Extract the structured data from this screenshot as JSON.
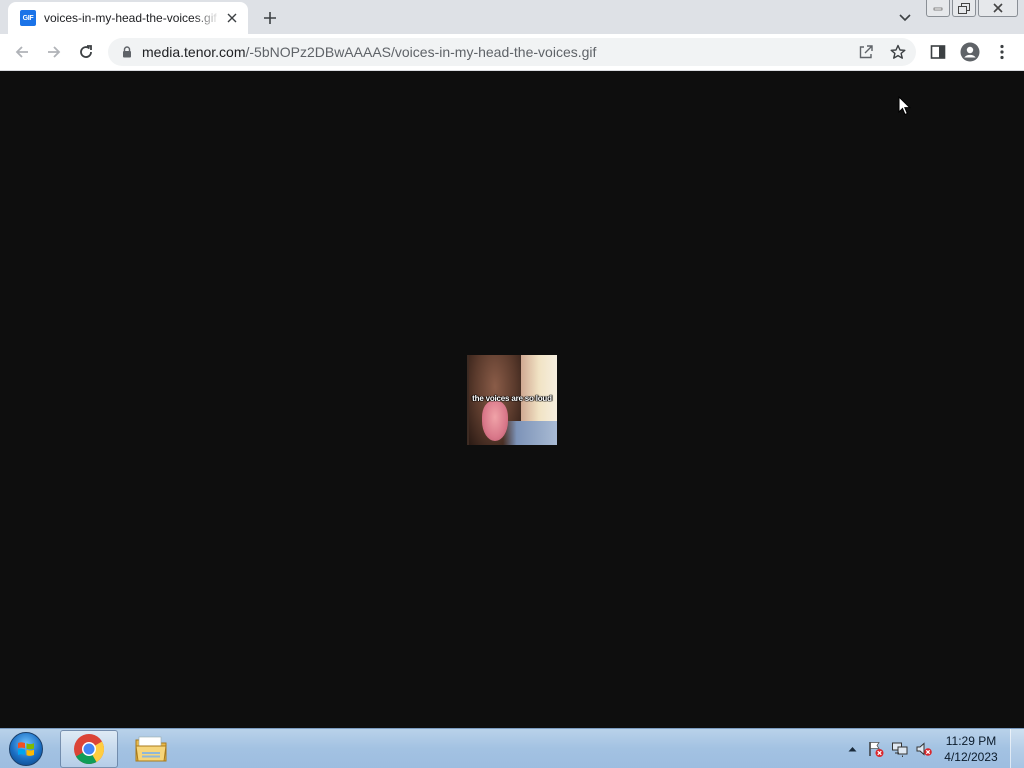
{
  "browser": {
    "tab": {
      "favicon_text": "GIF",
      "title": "voices-in-my-head-the-voices.gif"
    },
    "address": {
      "domain": "media.tenor.com",
      "path": "/-5bNOPz2DBwAAAAS/voices-in-my-head-the-voices.gif"
    }
  },
  "content": {
    "background": "#0e0e0e",
    "gif_caption": "the voices are so loud"
  },
  "taskbar": {
    "apps": [
      {
        "name": "Google Chrome",
        "icon": "chrome-icon",
        "active": true
      },
      {
        "name": "Windows Explorer",
        "icon": "folder-icon",
        "active": false
      }
    ],
    "clock": {
      "time": "11:29 PM",
      "date": "4/12/2023"
    },
    "tray_icons": [
      "show-hidden-icons-icon",
      "action-center-flag-icon",
      "network-icon",
      "volume-muted-icon"
    ]
  }
}
